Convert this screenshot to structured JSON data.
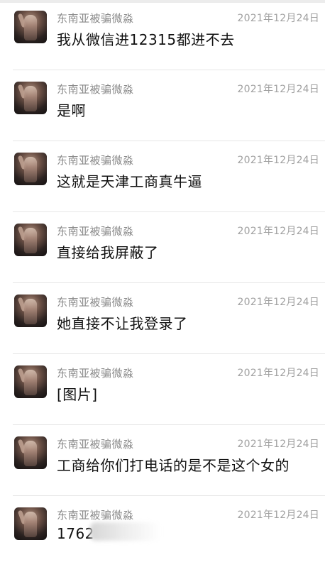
{
  "messages": [
    {
      "name": "东南亚被骗微淼",
      "time": "2021年12月24日",
      "text": "我从微信进12315都进不去"
    },
    {
      "name": "东南亚被骗微淼",
      "time": "2021年12月24日",
      "text": "是啊"
    },
    {
      "name": "东南亚被骗微淼",
      "time": "2021年12月24日",
      "text": "这就是天津工商真牛逼"
    },
    {
      "name": "东南亚被骗微淼",
      "time": "2021年12月24日",
      "text": "直接给我屏蔽了"
    },
    {
      "name": "东南亚被骗微淼",
      "time": "2021年12月24日",
      "text": "她直接不让我登录了"
    },
    {
      "name": "东南亚被骗微淼",
      "time": "2021年12月24日",
      "text": "[图片]"
    },
    {
      "name": "东南亚被骗微淼",
      "time": "2021年12月24日",
      "text": "工商给你们打电话的是不是这个女的"
    },
    {
      "name": "东南亚被骗微淼",
      "time": "2021年12月24日",
      "text": "1762"
    }
  ]
}
